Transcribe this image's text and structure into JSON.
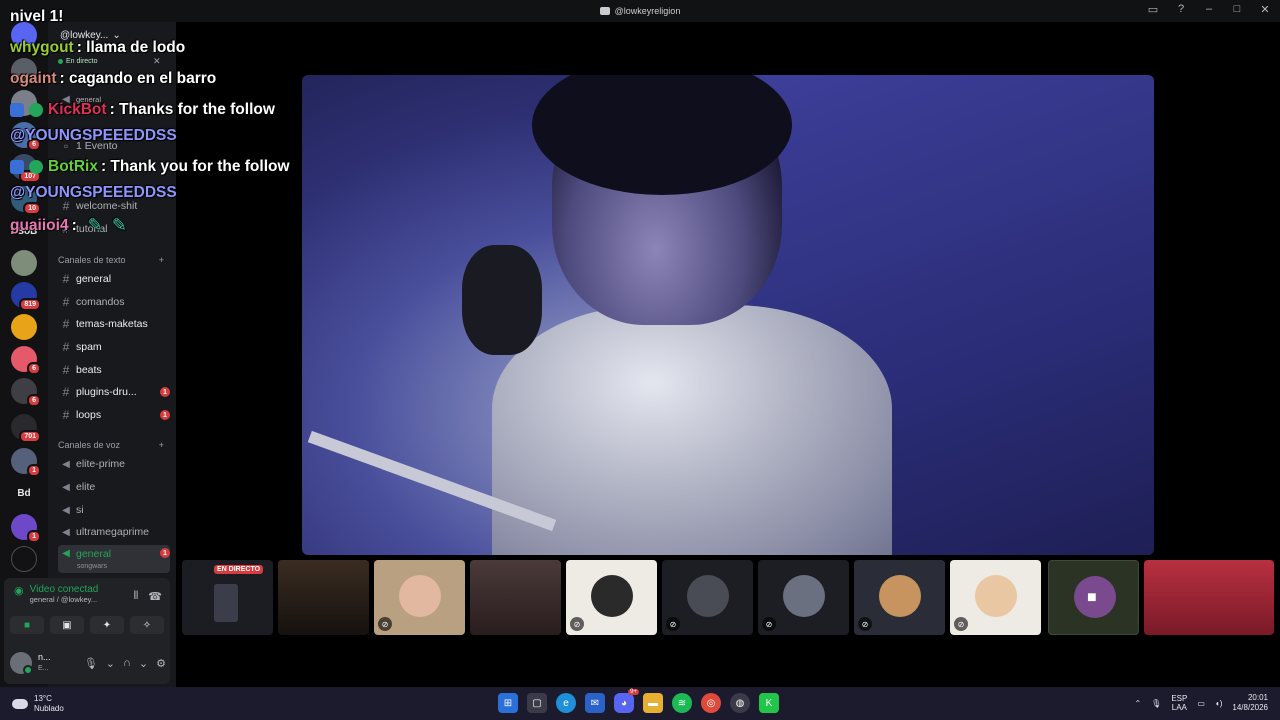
{
  "window": {
    "title": "@lowkeyreligion"
  },
  "server_header": "@lowkey...",
  "live_indicator": "En directo",
  "chat": [
    {
      "user": "",
      "text": "nivel 1!",
      "user_color": "#ffffff"
    },
    {
      "user": "whygout",
      "text": ": llama de lodo",
      "user_color": "#9acd32"
    },
    {
      "user": "ogaint",
      "text": ": cagando en el barro",
      "user_color": "#d88a7c"
    },
    {
      "user": "KickBot",
      "text": ": Thanks for the follow",
      "user_color": "#e0305a"
    },
    {
      "user": "@YOUNGSPEEEDDSS",
      "text": "",
      "user_color": "#8f96ff"
    },
    {
      "user": "BotRix",
      "text": ": Thank you for the follow",
      "user_color": "#65d13a"
    },
    {
      "user": "@YOUNGSPEEEDDSS",
      "text": "",
      "user_color": "#8f96ff"
    },
    {
      "user": "guaiioi4",
      "text": ":",
      "user_color": "#e878b4"
    }
  ],
  "channels_partial": {
    "general_top": "general",
    "evento": "1 Evento",
    "welcome": "welcome-shit",
    "tutorial": "tutorial"
  },
  "text_category": "Canales de texto",
  "text_channels": [
    {
      "name": "general",
      "unread": ""
    },
    {
      "name": "comandos",
      "unread": ""
    },
    {
      "name": "temas-maketas",
      "unread": ""
    },
    {
      "name": "spam",
      "unread": ""
    },
    {
      "name": "beats",
      "unread": ""
    },
    {
      "name": "plugins-dru...",
      "unread": "1"
    },
    {
      "name": "loops",
      "unread": "1"
    }
  ],
  "voice_category": "Canales de voz",
  "voice_channels": [
    {
      "name": "elite-prime",
      "unread": ""
    },
    {
      "name": "elite",
      "unread": ""
    },
    {
      "name": "si",
      "unread": ""
    },
    {
      "name": "ultramegaprime",
      "unread": ""
    },
    {
      "name": "general",
      "unread": "1",
      "sub": "songwars"
    }
  ],
  "voice_panel": {
    "status": "Video conectad",
    "location": "general / @lowkey...",
    "user_name": "n...",
    "user_sub": "E..."
  },
  "rail_badges": [
    "6",
    "107",
    "10",
    "819",
    "6",
    "6",
    "701",
    "1",
    "1"
  ],
  "rail_labels": {
    "esob": "ESoB",
    "bd": "Bd"
  },
  "thumbs": {
    "live_label": "EN DIRECTO"
  },
  "taskbar": {
    "temp": "13°C",
    "weather": "Nublado",
    "lang1": "ESP",
    "lang2": "LAA",
    "time": "20:01",
    "date": "14/8/2026",
    "discord_badge": "9+"
  },
  "colors": {
    "accent_green": "#23a55a",
    "danger": "#d83c3e",
    "bg": "#18191c"
  }
}
